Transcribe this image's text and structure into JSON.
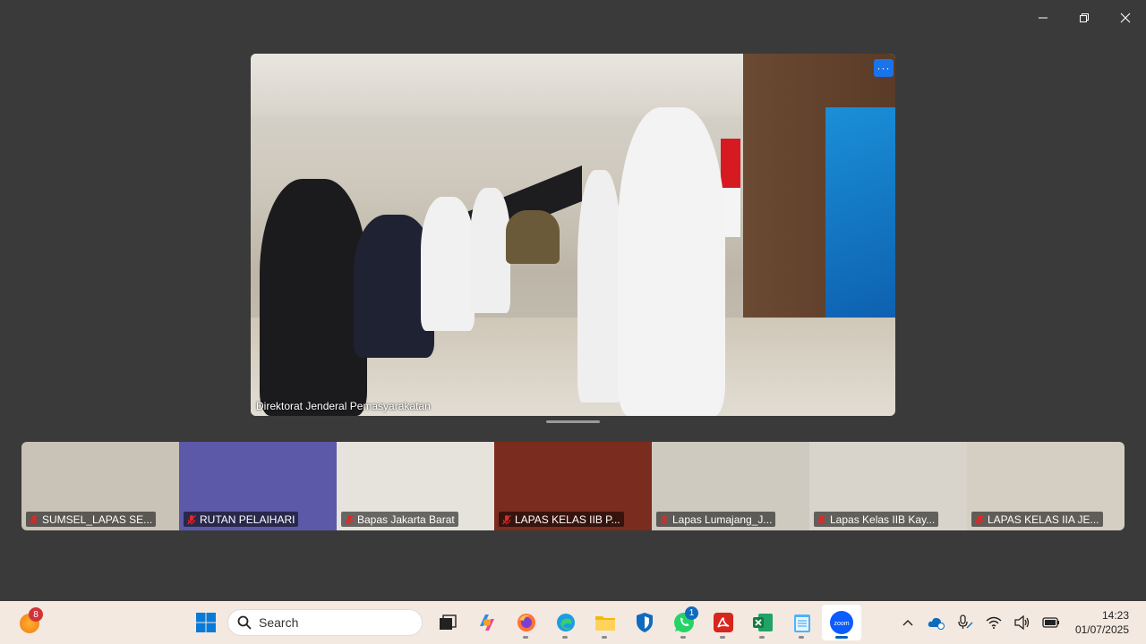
{
  "window": {
    "minimize": "minimize",
    "restore": "restore",
    "close": "close"
  },
  "main_video": {
    "participant_name": "Direktorat Jenderal Pemasyarakatan",
    "more_label": "···"
  },
  "gallery": [
    {
      "name": "SUMSEL_LAPAS SE...",
      "bg": "#c9c2b6"
    },
    {
      "name": "RUTAN PELAIHARI",
      "bg": "#5c5aa8"
    },
    {
      "name": "Bapas Jakarta Barat",
      "bg": "#e6e3dc"
    },
    {
      "name": "LAPAS KELAS IIB P...",
      "bg": "#7a2c1e"
    },
    {
      "name": "Lapas Lumajang_J...",
      "bg": "#cfcac0"
    },
    {
      "name": "Lapas Kelas IIB Kay...",
      "bg": "#d9d4cb"
    },
    {
      "name": "LAPAS KELAS IIA JE...",
      "bg": "#d5cfc3"
    }
  ],
  "taskbar": {
    "weather_badge": "8",
    "search_placeholder": "Search",
    "whatsapp_badge": "1",
    "time": "14:23",
    "date": "01/07/2025"
  }
}
